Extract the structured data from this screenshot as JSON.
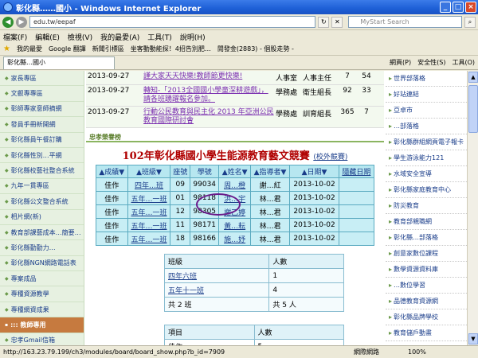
{
  "window": {
    "title": "彰化縣……國小 - Windows Internet Explorer"
  },
  "address": {
    "url": "edu.tw/eepaf",
    "search_placeholder": "MyStart Search"
  },
  "menu": [
    "檔案(F)",
    "編輯(E)",
    "檢視(V)",
    "我的最愛(A)",
    "工具(T)",
    "說明(H)"
  ],
  "favorites": [
    "我的最愛",
    "Google 翻譯",
    "新聞引標區",
    "坐客動動能探！4招告別肥…",
    "閱發金(2883) - 個股走勢 -"
  ],
  "tab": {
    "label": "彰化縣…國小"
  },
  "commands": [
    "網頁(P)",
    "安全性(S)",
    "工具(O)"
  ],
  "left_nav": [
    "家長專區",
    "文叡專專區",
    "彰師專家意師摘網",
    "發員手冊新開網",
    "彰化縣員午餐訂購",
    "彰化縣性別…平網",
    "彰化縣校藝社整合系統",
    "九年一貫專區",
    "彰化縣公文整合系統",
    "相片網(新)",
    "教育部課藝成本…簡要…",
    "彰化縣勤勤力…",
    "彰化縣NGN網路電話表",
    "專案成品",
    "專種資源教學",
    "專種網資成果",
    "彰化縣NGN網路電話表",
    "網管借用",
    "::: 教師專用",
    "忠孝Gmail信箱",
    "彰師網路硬碟"
  ],
  "news": [
    {
      "date": "2013-09-27",
      "title": "謹大家天天快樂!教師節更快樂!",
      "dept": "人事室",
      "who": "人事主任",
      "n1": "7",
      "n2": "54"
    },
    {
      "date": "2013-09-27",
      "title": "轉知-「2013全國國小學童深耕遊戲」，請各班踴躍報名參加。",
      "dept": "學務處",
      "who": "衛生組長",
      "n1": "92",
      "n2": "33"
    },
    {
      "date": "2013-09-27",
      "title": "行動公民教育與民主化 2013 年亞洲公民教育國際研討會",
      "dept": "學務處",
      "who": "訓育組長",
      "n1": "365",
      "n2": "7"
    }
  ],
  "ribbon": "忠孝榮譽榜",
  "contest": {
    "title": "102年彰化縣國小學生能源教育藝文競賽",
    "link": "(校外競賽)",
    "headers": [
      "▲成績▼",
      "▲班級▼",
      "座號",
      "學號",
      "▲姓名▼",
      "▲指導者▼",
      "▲日期▼",
      "隱藏日期"
    ],
    "rows": [
      {
        "grade": "佳作",
        "cls": "四年…班",
        "seat": "09",
        "id": "99034",
        "name": "周…橙",
        "teacher": "謝…紅",
        "date": "2013-10-02"
      },
      {
        "grade": "佳作",
        "cls": "五年…一班",
        "seat": "01",
        "id": "98118",
        "name": "洪…宇",
        "teacher": "林…君",
        "date": "2013-10-02"
      },
      {
        "grade": "佳作",
        "cls": "五年…一班",
        "seat": "12",
        "id": "98305",
        "name": "謝乙婷",
        "teacher": "林…君",
        "date": "2013-10-02"
      },
      {
        "grade": "佳作",
        "cls": "五年…一班",
        "seat": "11",
        "id": "98171",
        "name": "黃…耘",
        "teacher": "林…君",
        "date": "2013-10-02"
      },
      {
        "grade": "佳作",
        "cls": "五年…一班",
        "seat": "18",
        "id": "98166",
        "name": "施…妤",
        "teacher": "林…君",
        "date": "2013-10-02"
      }
    ]
  },
  "summary": {
    "headers": [
      "班級",
      "人數"
    ],
    "rows": [
      {
        "cls": "四年六班",
        "count": "1"
      },
      {
        "cls": "五年十一班",
        "count": "4"
      }
    ],
    "total_label": "共 2 班",
    "total_count": "共 5 人"
  },
  "summary2": {
    "headers": [
      "項目",
      "人數"
    ],
    "first_row": [
      "佳作",
      "5"
    ]
  },
  "right_nav": [
    "世界部落格",
    "好站連結",
    "亞卓市",
    "…部落格",
    "…部落格",
    "彰化縣群組網頁電子報卡",
    "學生游泳能力121",
    "水域安全宣導",
    "彰化縣家庭教育中心",
    "防災教育",
    "教育部親職網",
    "彰化縣…部落格",
    "創意家數位課程",
    "數學資源資料庫",
    "…數位學習",
    "品德教育資源網",
    "彰化縣品牌學校",
    "教育儲戶動畫",
    "性教育教學資源網",
    "兩岸家園跳轉綠色生活網",
    "彰化縣運動推廣資訊網"
  ],
  "status": {
    "url": "http://163.23.79.199/ch3/modules/board/board_show.php?b_id=7909",
    "zone": "網際網路",
    "zoom": "100%"
  }
}
